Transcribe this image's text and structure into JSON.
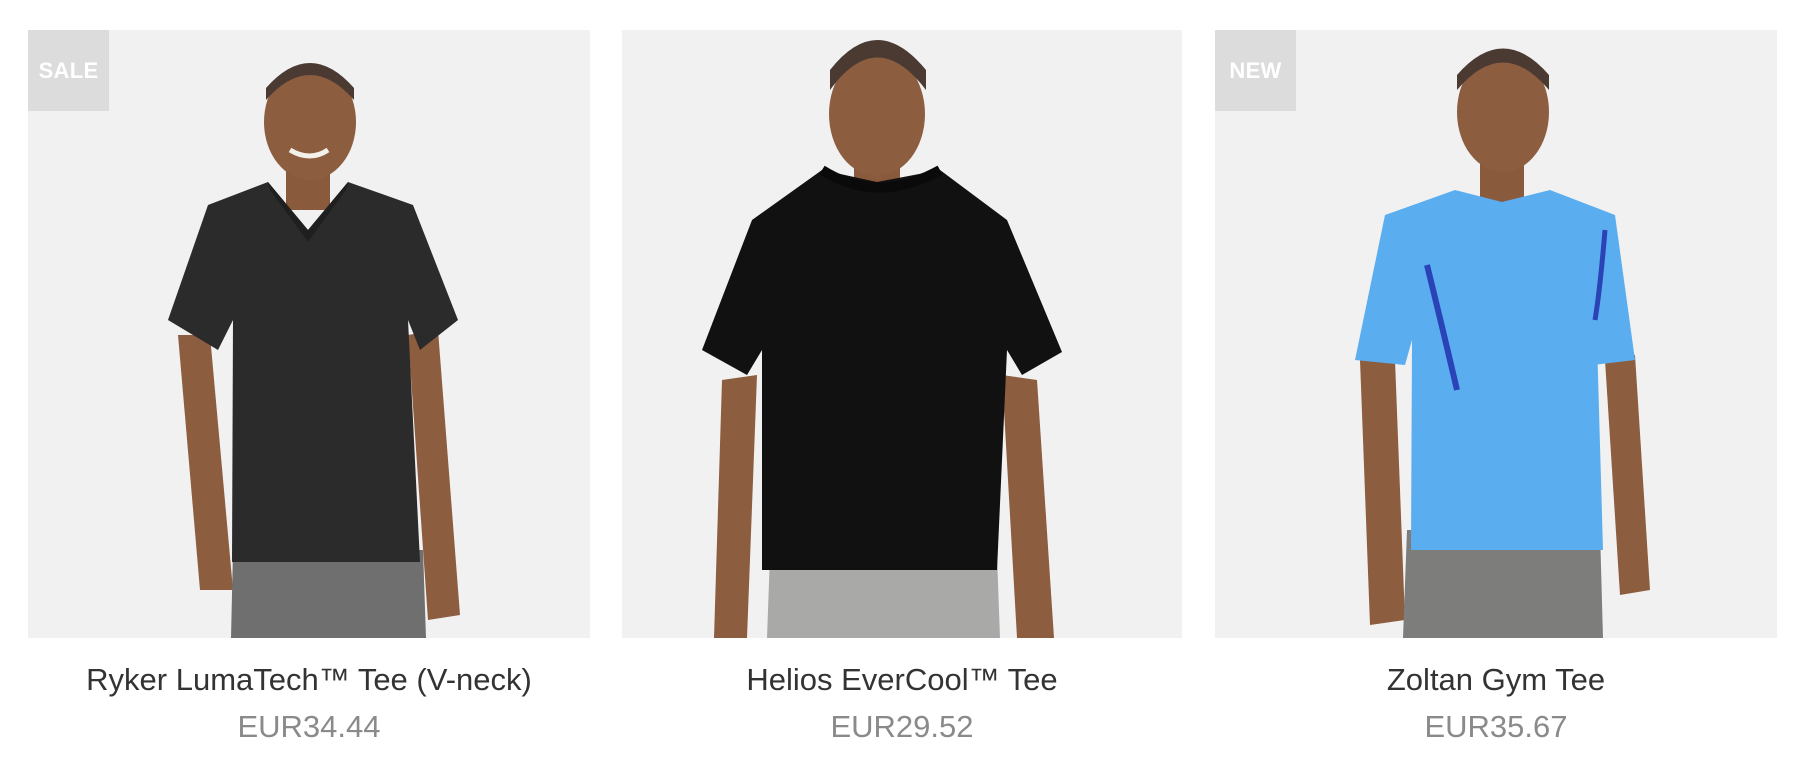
{
  "products": [
    {
      "badge": "SALE",
      "name": "Ryker LumaTech™ Tee (V-neck)",
      "price": "EUR34.44",
      "image": {
        "subject": "model wearing black v-neck tee",
        "shirt_color": "#2b2b2b",
        "shorts_color": "#6f6f6f"
      }
    },
    {
      "badge": "",
      "name": "Helios EverCool™ Tee",
      "price": "EUR29.52",
      "image": {
        "subject": "model wearing black crew-neck tee",
        "shirt_color": "#111111",
        "shorts_color": "#a9a9a7"
      }
    },
    {
      "badge": "NEW",
      "name": "Zoltan Gym Tee",
      "price": "EUR35.67",
      "image": {
        "subject": "model wearing light blue gym tee",
        "shirt_color": "#5aaef0",
        "shorts_color": "#7d7d7b"
      }
    }
  ],
  "colors": {
    "image_bg": "#f1f1f1",
    "badge_bg": "#dcdcdc",
    "name_text": "#333333",
    "price_text": "#8a8a8a"
  }
}
